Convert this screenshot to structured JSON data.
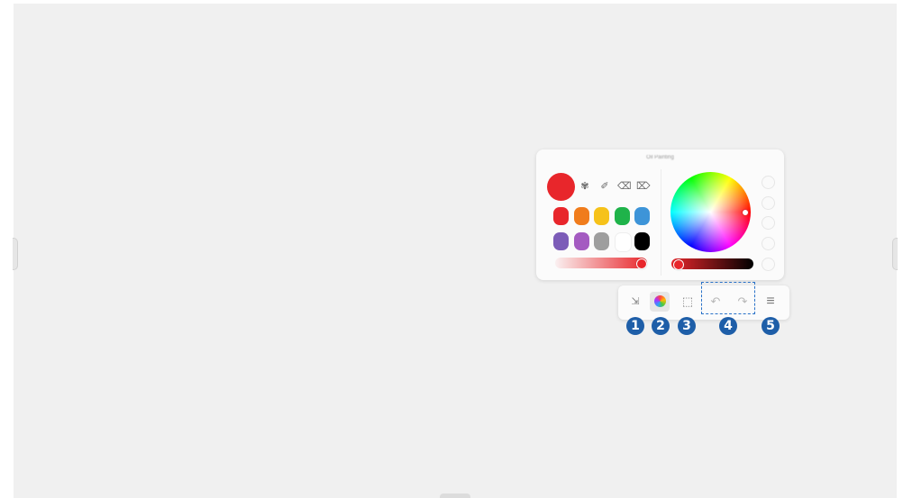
{
  "panel": {
    "title": "Oil Painting",
    "tools": [
      {
        "icon": "brush-fan-icon",
        "glyph": "✾"
      },
      {
        "icon": "pen-icon",
        "glyph": "✐"
      },
      {
        "icon": "eraser-icon",
        "glyph": "⌫"
      },
      {
        "icon": "clear-eraser-icon",
        "glyph": "⌦"
      }
    ],
    "selected_color": "#e8262b",
    "swatches": [
      "#e8262b",
      "#f07c1c",
      "#f6c21a",
      "#1fb34a",
      "#3d94d8",
      "#7c5cb8",
      "#a45bc1",
      "#9e9e9e",
      "#ffffff",
      "#000000"
    ],
    "opacity_level": 1.0,
    "brightness_level": 0.0
  },
  "toolbar": {
    "buttons": [
      {
        "icon": "collapse-icon",
        "glyph": "⇲"
      },
      {
        "icon": "color-palette-icon",
        "glyph": ""
      },
      {
        "icon": "selection-icon",
        "glyph": "⬚"
      },
      {
        "icon": "undo-icon",
        "glyph": "↶"
      },
      {
        "icon": "redo-icon",
        "glyph": "↷"
      },
      {
        "icon": "menu-icon",
        "glyph": "≡"
      }
    ]
  },
  "callouts": [
    "1",
    "2",
    "3",
    "4",
    "5"
  ]
}
